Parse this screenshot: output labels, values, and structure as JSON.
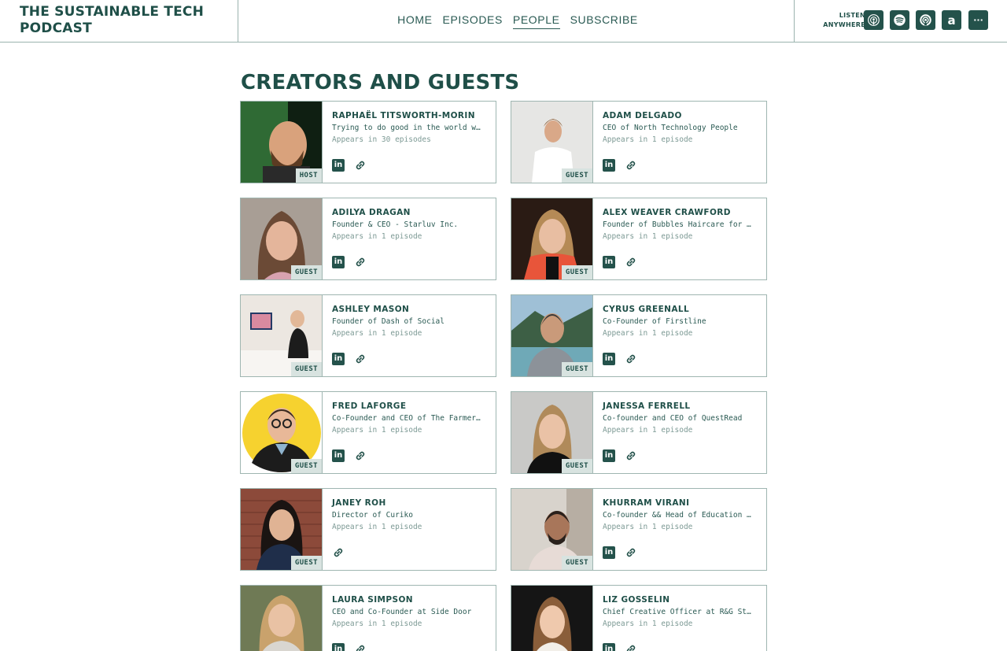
{
  "header": {
    "brand_line1": "THE SUSTAINABLE TECH",
    "brand_line2": "PODCAST",
    "nav": [
      {
        "label": "HOME",
        "active": false
      },
      {
        "label": "EPISODES",
        "active": false
      },
      {
        "label": "PEOPLE",
        "active": true
      },
      {
        "label": "SUBSCRIBE",
        "active": false
      }
    ],
    "listen_line1": "LISTEN",
    "listen_line2": "ANYWHERE",
    "platforms": [
      "apple-podcasts-icon",
      "spotify-icon",
      "overcast-icon",
      "amazon-music-icon",
      "more-icon"
    ],
    "amazon_glyph": "a",
    "more_glyph": "···"
  },
  "page_title": "CREATORS AND GUESTS",
  "linkedin_glyph": "in",
  "people": [
    {
      "name": "RAPHAËL TITSWORTH-MORIN",
      "role": "Trying to do good in the world w…",
      "appears": "Appears in 30 episodes",
      "badge": "HOST",
      "linkedin": true
    },
    {
      "name": "ADAM DELGADO",
      "role": "CEO of North Technology People",
      "appears": "Appears in 1 episode",
      "badge": "GUEST",
      "linkedin": true
    },
    {
      "name": "ADILYA DRAGAN",
      "role": "Founder & CEO - Starluv Inc.",
      "appears": "Appears in 1 episode",
      "badge": "GUEST",
      "linkedin": true
    },
    {
      "name": "ALEX WEAVER CRAWFORD",
      "role": "Founder of Bubbles Haircare for …",
      "appears": "Appears in 1 episode",
      "badge": "GUEST",
      "linkedin": true
    },
    {
      "name": "ASHLEY MASON",
      "role": "Founder of Dash of Social",
      "appears": "Appears in 1 episode",
      "badge": "GUEST",
      "linkedin": true
    },
    {
      "name": "CYRUS GREENALL",
      "role": "Co-Founder of Firstline",
      "appears": "Appears in 1 episode",
      "badge": "GUEST",
      "linkedin": true
    },
    {
      "name": "FRED LAFORGE",
      "role": "Co-Founder and CEO of The Farmer…",
      "appears": "Appears in 1 episode",
      "badge": "GUEST",
      "linkedin": true
    },
    {
      "name": "JANESSA FERRELL",
      "role": "Co-founder and CEO of QuestRead",
      "appears": "Appears in 1 episode",
      "badge": "GUEST",
      "linkedin": true
    },
    {
      "name": "JANEY ROH",
      "role": "Director of Curiko",
      "appears": "Appears in 1 episode",
      "badge": "GUEST",
      "linkedin": false
    },
    {
      "name": "KHURRAM VIRANI",
      "role": "Co-founder && Head of Education …",
      "appears": "Appears in 1 episode",
      "badge": "GUEST",
      "linkedin": true
    },
    {
      "name": "LAURA SIMPSON",
      "role": "CEO and Co-Founder at Side Door",
      "appears": "Appears in 1 episode",
      "badge": "GUEST",
      "linkedin": true
    },
    {
      "name": "LIZ GOSSELIN",
      "role": "Chief Creative Officer at R&G St…",
      "appears": "Appears in 1 episode",
      "badge": "GUEST",
      "linkedin": true
    }
  ]
}
